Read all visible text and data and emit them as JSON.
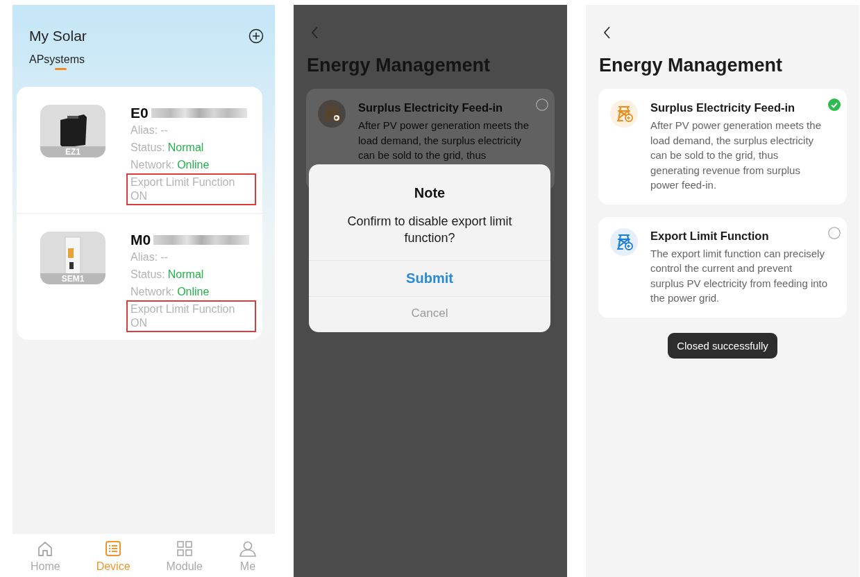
{
  "screens": [
    {
      "kind": "device_list",
      "title": "My Solar",
      "tabs": [
        {
          "label": "APsystems",
          "selected": true
        }
      ],
      "devices": [
        {
          "name": "E0",
          "image_label": "EZ1",
          "alias_label": "Alias:",
          "alias": "--",
          "status_label": "Status:",
          "status": "Normal",
          "network_label": "Network:",
          "network": "Online",
          "export_limit_label": "Export Limit Function",
          "export_limit": "ON",
          "highlighted": true
        },
        {
          "name": "M0",
          "image_label": "SEM1",
          "alias_label": "Alias:",
          "alias": "--",
          "status_label": "Status:",
          "status": "Normal",
          "network_label": "Network:",
          "network": "Online",
          "export_limit_label": "Export Limit Function",
          "export_limit": "ON",
          "highlighted": true
        }
      ],
      "nav": [
        {
          "label": "Home",
          "selected": false
        },
        {
          "label": "Device",
          "selected": true
        },
        {
          "label": "Module",
          "selected": false
        },
        {
          "label": "Me",
          "selected": false
        }
      ]
    },
    {
      "kind": "dialog",
      "title": "Energy Management",
      "options": [
        {
          "title": "Surplus Electricity Feed-in",
          "description": "After PV power generation meets the load demand, the surplus electricity can be sold to the grid, thus",
          "selected": false,
          "color": "#5e4220"
        }
      ],
      "dialog": {
        "title": "Note",
        "message": "Confirm to disable export limit function?",
        "buttons": [
          {
            "label": "Submit",
            "kind": "primary"
          },
          {
            "label": "Cancel",
            "kind": "secondary"
          }
        ]
      }
    },
    {
      "kind": "options",
      "title": "Energy Management",
      "options": [
        {
          "title": "Surplus Electricity Feed-in",
          "description": "After PV power generation meets the load demand, the surplus electricity can be sold to the grid, thus generating revenue from surplus power feed-in.",
          "selected": true,
          "color": "#f08c1a"
        },
        {
          "title": "Export Limit Function",
          "description": "The export limit function can precisely control the current and prevent surplus PV electricity from feeding into the power grid.",
          "selected": false,
          "color": "#1e7fd8"
        }
      ],
      "toast": "Closed successfully"
    }
  ]
}
